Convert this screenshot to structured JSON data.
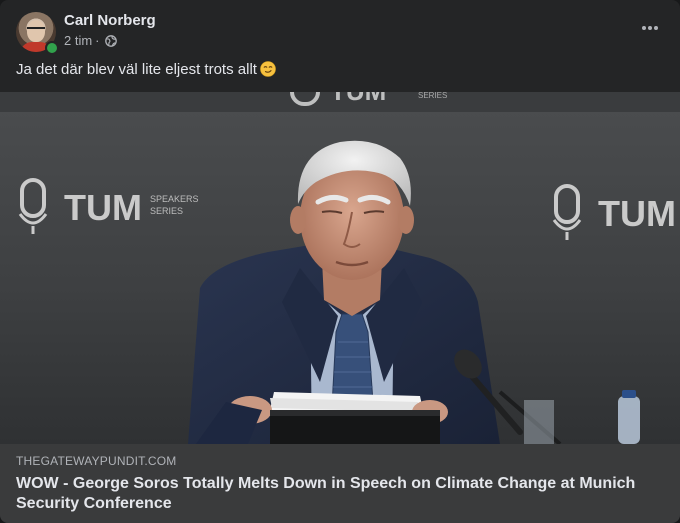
{
  "post": {
    "author": "Carl Norberg",
    "time": "2 tim",
    "separator": "·",
    "privacy_icon": "globe-icon",
    "more_icon": "more-horizontal-icon",
    "text": "Ja det där blev väl lite eljest trots allt",
    "emoji": "smirk-emoji"
  },
  "media": {
    "banner_left": "TUM",
    "banner_left_small_1": "SPEAKERS",
    "banner_left_small_2": "SERIES",
    "banner_right": "TUM",
    "banner_top": "TUM",
    "banner_top_small": "SERIES"
  },
  "link": {
    "domain": "THEGATEWAYPUNDIT.COM",
    "title": "WOW - George Soros Totally Melts Down in Speech on Climate Change at Munich Security Conference"
  },
  "colors": {
    "card_bg": "#242526",
    "footer_bg": "#3a3b3c",
    "text_primary": "#e4e6eb",
    "text_secondary": "#b0b3b8",
    "online": "#31a24c"
  }
}
